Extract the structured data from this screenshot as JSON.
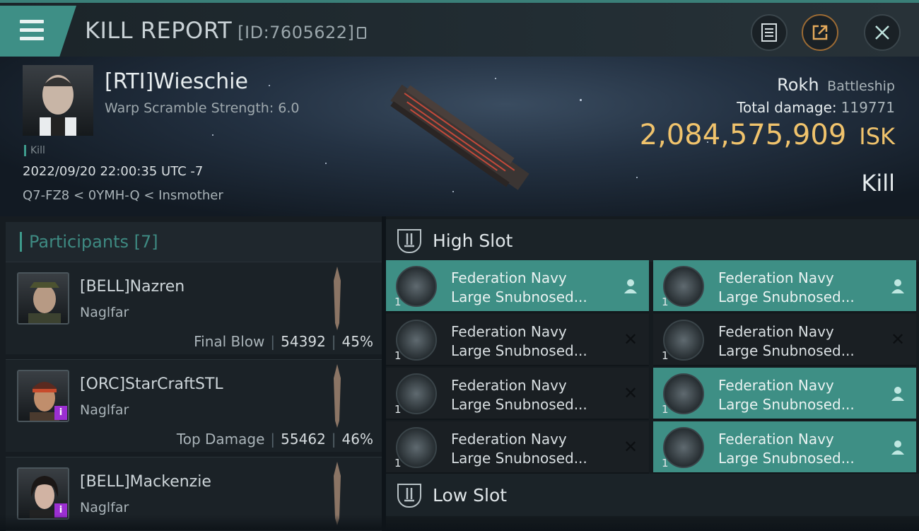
{
  "header": {
    "title": "KILL REPORT",
    "report_id": "[ID:7605622]"
  },
  "victim": {
    "name": "[RTI]Wieschie",
    "warp_scramble": "Warp Scramble Strength: 6.0",
    "tag": "Kill",
    "datetime": "2022/09/20 22:00:35 UTC -7",
    "location": "Q7-FZ8 < 0YMH-Q < Insmother",
    "ship_name": "Rokh",
    "ship_class": "Battleship",
    "total_damage_label": "Total damage:",
    "total_damage": "119771",
    "isk_value": "2,084,575,909",
    "isk_unit": "ISK",
    "result": "Kill"
  },
  "participants": {
    "label": "Participants",
    "count": "[7]",
    "items": [
      {
        "name": "[BELL]Nazren",
        "ship": "Naglfar",
        "stat_label": "Final Blow",
        "damage": "54392",
        "percent": "45%"
      },
      {
        "name": "[ORC]StarCraftSTL",
        "ship": "Naglfar",
        "stat_label": "Top Damage",
        "damage": "55462",
        "percent": "46%"
      },
      {
        "name": "[BELL]Mackenzie",
        "ship": "Naglfar"
      }
    ]
  },
  "slots": {
    "high_title": "High Slot",
    "low_title": "Low Slot",
    "high_modules": [
      {
        "line1": "Federation Navy",
        "line2": "Large Snubnosed...",
        "qty": "1",
        "status": "dropped"
      },
      {
        "line1": "Federation Navy",
        "line2": "Large Snubnosed...",
        "qty": "1",
        "status": "dropped"
      },
      {
        "line1": "Federation Navy",
        "line2": "Large Snubnosed...",
        "qty": "1",
        "status": "destroyed"
      },
      {
        "line1": "Federation Navy",
        "line2": "Large Snubnosed...",
        "qty": "1",
        "status": "destroyed"
      },
      {
        "line1": "Federation Navy",
        "line2": "Large Snubnosed...",
        "qty": "1",
        "status": "destroyed"
      },
      {
        "line1": "Federation Navy",
        "line2": "Large Snubnosed...",
        "qty": "1",
        "status": "dropped"
      },
      {
        "line1": "Federation Navy",
        "line2": "Large Snubnosed...",
        "qty": "1",
        "status": "destroyed"
      },
      {
        "line1": "Federation Navy",
        "line2": "Large Snubnosed...",
        "qty": "1",
        "status": "dropped"
      }
    ]
  },
  "icons": {
    "destroyed": "✕",
    "dropped": "person-icon",
    "badge": "i"
  },
  "colors": {
    "accent": "#3e8f86",
    "isk": "#f0c36c"
  }
}
